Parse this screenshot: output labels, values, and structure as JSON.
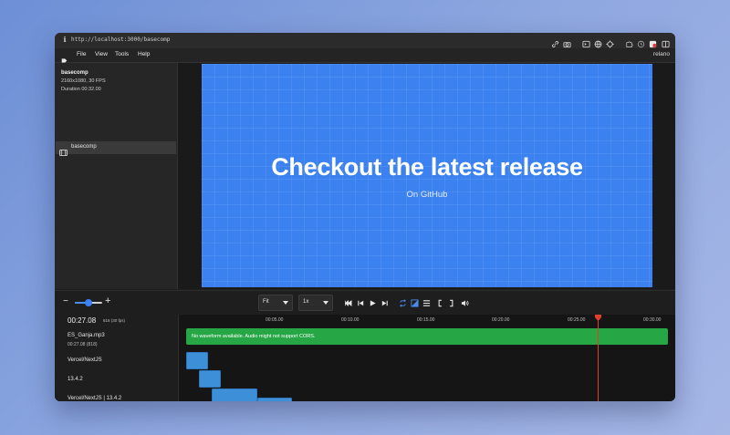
{
  "browser": {
    "url": "http://localhost:3000/basecomp"
  },
  "menu": {
    "items": [
      "File",
      "View",
      "Tools",
      "Help"
    ],
    "brand": "relano"
  },
  "composition": {
    "name": "basecomp",
    "resolution": "2160x1080, 30 FPS",
    "duration": "Duration 00:32.00",
    "list_item": "basecomp"
  },
  "preview": {
    "headline": "Checkout the latest release",
    "subline": "On GitHub",
    "bg_color": "#3b82f0"
  },
  "controls": {
    "zoom_minus": "−",
    "zoom_plus": "+",
    "zoom_level": 0.5,
    "fit_label": "Fit",
    "speed_label": "1x"
  },
  "timeline": {
    "timecode": "00:27.08",
    "frame_info": "818 (30 fps)",
    "audio_name": "ES_Ganja.mp3",
    "audio_time": "00:27.08 (818)",
    "tracks": [
      "Vercel/NextJS",
      "13.4.2",
      "Vercel/NextJS | 13.4.2"
    ],
    "ticks": [
      "00:05.00",
      "00:10.00",
      "00:15.00",
      "00:20.00",
      "00:25.00",
      "00:30.00"
    ],
    "audio_message": "No waveform available. Audio might not support CORS.",
    "playhead_time": "00:27.08"
  }
}
